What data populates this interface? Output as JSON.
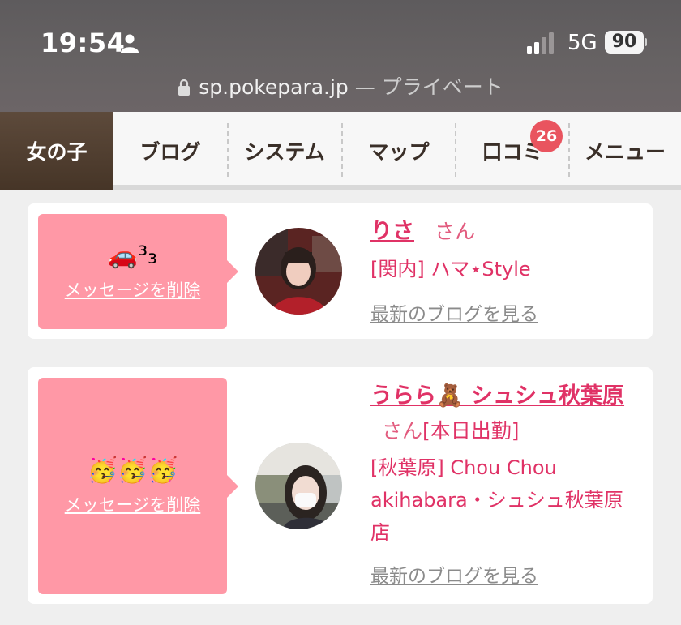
{
  "status_bar": {
    "time": "19:54",
    "network": "5G",
    "battery": "90"
  },
  "browser": {
    "url": "sp.pokepara.jp",
    "mode": "— プライベート"
  },
  "nav": {
    "tabs": [
      {
        "label": "女の子"
      },
      {
        "label": "ブログ"
      },
      {
        "label": "システム"
      },
      {
        "label": "マップ"
      },
      {
        "label": "口コミ"
      },
      {
        "label": "メニュー"
      }
    ],
    "reviews_badge": "26"
  },
  "messages": [
    {
      "emoji": "🚗³₃",
      "delete_label": "メッセージを削除",
      "name": "りさ",
      "honorific": "さん",
      "status": "",
      "shop": "[関内] ハマ⋆Style",
      "blog_label": "最新のブログを見る"
    },
    {
      "emoji": "🥳🥳🥳",
      "delete_label": "メッセージを削除",
      "name": "うらら🧸 シュシュ秋葉原",
      "honorific": "さん",
      "status": "[本日出勤]",
      "shop": "[秋葉原] Chou Chou akihabara・シュシュ秋葉原店",
      "blog_label": "最新のブログを見る"
    }
  ],
  "colors": {
    "accent": "#e03266",
    "pink_panel": "#ff98a6",
    "nav_active": "#4f3e30",
    "badge": "#e9545f"
  }
}
